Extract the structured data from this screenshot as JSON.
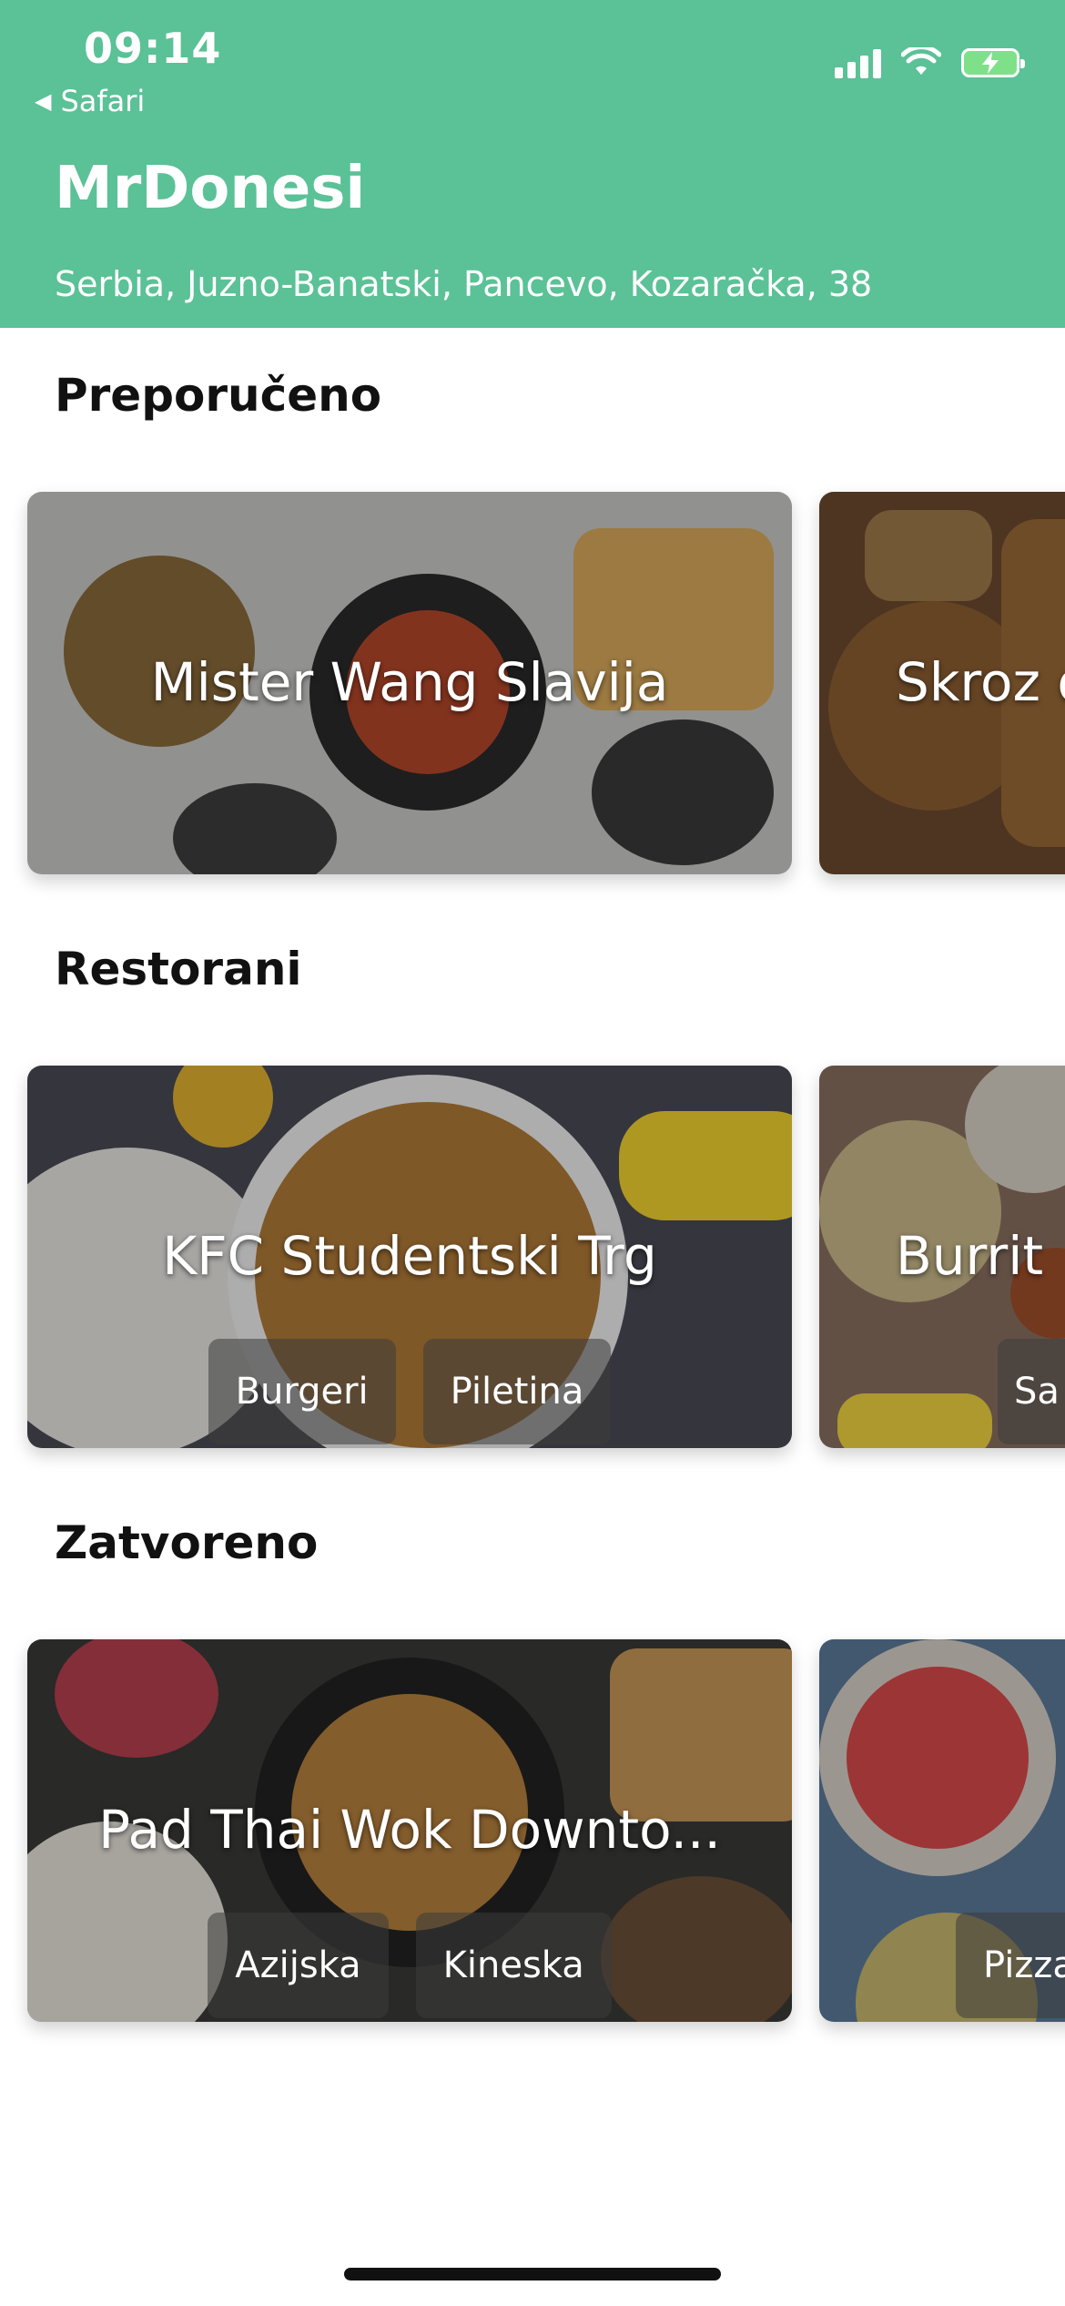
{
  "status_bar": {
    "time": "09:14",
    "back_label": "Safari",
    "battery": "charging"
  },
  "header": {
    "title": "MrDonesi",
    "address": "Serbia, Juzno-Banatski, Pancevo, Kozaračka, 38",
    "background_color": "#5bc197"
  },
  "sections": [
    {
      "title": "Preporučeno",
      "cards": [
        {
          "name": "Mister Wang Slavija",
          "tags": []
        },
        {
          "name": "Skroz d",
          "tags": []
        }
      ]
    },
    {
      "title": "Restorani",
      "cards": [
        {
          "name": "KFC Studentski Trg",
          "tags": [
            "Burgeri",
            "Piletina"
          ]
        },
        {
          "name": "Burrit",
          "tags": [
            "Sa"
          ]
        }
      ]
    },
    {
      "title": "Zatvoreno",
      "cards": [
        {
          "name": "Pad Thai Wok Downto...",
          "tags": [
            "Azijska",
            "Kineska"
          ]
        },
        {
          "name": "",
          "tags": [
            "Pizza"
          ]
        }
      ]
    }
  ]
}
